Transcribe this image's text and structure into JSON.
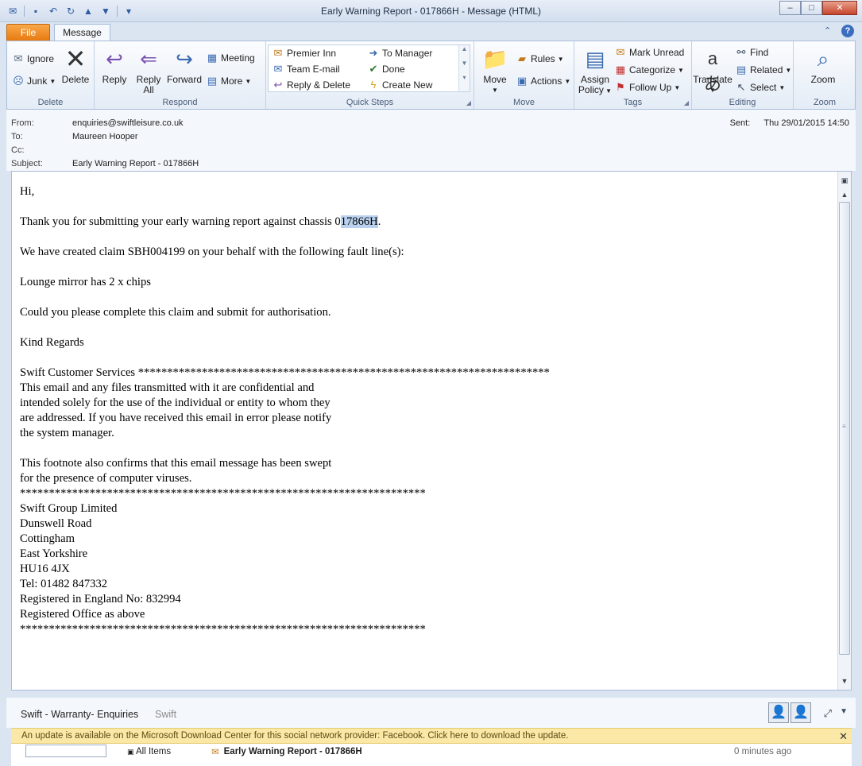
{
  "window": {
    "title": "Early Warning Report - 017866H  -  Message (HTML)",
    "min_label": "–",
    "max_label": "□",
    "close_label": "✕"
  },
  "tabs": {
    "file": "File",
    "message": "Message"
  },
  "ribbon": {
    "delete_group": {
      "label": "Delete",
      "ignore": "Ignore",
      "junk": "Junk",
      "delete": "Delete"
    },
    "respond_group": {
      "label": "Respond",
      "reply": "Reply",
      "reply_all_1": "Reply",
      "reply_all_2": "All",
      "forward": "Forward",
      "meeting": "Meeting",
      "more": "More"
    },
    "quick_steps_group": {
      "label": "Quick Steps",
      "items": [
        "Premier Inn",
        "To Manager",
        "Team E-mail",
        "Done",
        "Reply & Delete",
        "Create New"
      ]
    },
    "move_group": {
      "label": "Move",
      "move": "Move",
      "rules": "Rules",
      "actions": "Actions"
    },
    "tags_group": {
      "label": "Tags",
      "assign_policy_1": "Assign",
      "assign_policy_2": "Policy",
      "mark_unread": "Mark Unread",
      "categorize": "Categorize",
      "follow_up": "Follow Up"
    },
    "editing_group": {
      "label": "Editing",
      "translate": "Translate",
      "find": "Find",
      "related": "Related",
      "select": "Select"
    },
    "zoom_group": {
      "label": "Zoom",
      "zoom": "Zoom"
    }
  },
  "header": {
    "from_label": "From:",
    "from": "enquiries@swiftleisure.co.uk",
    "to_label": "To:",
    "to": "Maureen Hooper",
    "cc_label": "Cc:",
    "cc": "",
    "subject_label": "Subject:",
    "subject": "Early Warning Report - 017866H",
    "sent_label": "Sent:",
    "sent": "Thu 29/01/2015 14:50"
  },
  "body": {
    "greeting": "Hi,",
    "line1_pre": "Thank you for submitting your early warning report against chassis 0",
    "line1_sel": "17866H",
    "line1_post": ".",
    "line2": "We have created claim SBH004199 on your behalf with the following fault line(s):",
    "line3": "Lounge mirror has 2 x chips",
    "line4": "Could you please complete this claim and submit for authorisation.",
    "line5": "Kind Regards",
    "sig1": "Swift Customer Services ***********************************************************************",
    "sig2": "This email and any files transmitted with it are confidential and",
    "sig3": "intended solely for the use of the individual or entity to whom they",
    "sig4": "are addressed. If you have received this email in error please notify",
    "sig5": "the system manager.",
    "sig6": "This footnote also confirms that this email message has been swept",
    "sig7": "for the presence of computer viruses.",
    "sig8": "**********************************************************************",
    "addr1": "Swift Group Limited",
    "addr2": "Dunswell Road",
    "addr3": "Cottingham",
    "addr4": "East Yorkshire",
    "addr5": "HU16 4JX",
    "addr6": "Tel: 01482 847332",
    "addr7": "Registered in England No: 832994",
    "addr8": "Registered Office as above",
    "addr9": "**********************************************************************"
  },
  "social": {
    "name": "Swift - Warranty- Enquiries",
    "sub": "Swift"
  },
  "infobar": {
    "text": "An update is available on the Microsoft Download Center for this social network provider: Facebook. Click here to download the update."
  },
  "bottom": {
    "all_items": "All Items",
    "mail_subject": "Early Warning Report - 017866H",
    "ago": "0 minutes ago"
  }
}
